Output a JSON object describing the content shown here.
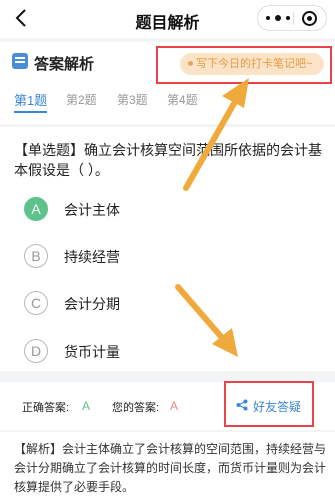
{
  "navbar": {
    "title": "题目解析",
    "back_icon": "chevron-left-icon",
    "menu_icon": "more-dots-icon",
    "record_icon": "record-circle-icon"
  },
  "section": {
    "icon": "document-icon",
    "title": "答案解析",
    "note_placeholder": "写下今日的打卡笔记吧~"
  },
  "tabs": [
    {
      "label": "第1题",
      "active": true
    },
    {
      "label": "第2题",
      "active": false
    },
    {
      "label": "第3题",
      "active": false
    },
    {
      "label": "第4题",
      "active": false
    }
  ],
  "question": {
    "text": "【单选题】确立会计核算空间范围所依据的会计基本假设是（    ）。",
    "options": [
      {
        "letter": "A",
        "text": "会计主体",
        "correct": true
      },
      {
        "letter": "B",
        "text": "持续经营",
        "correct": false
      },
      {
        "letter": "C",
        "text": "会计分期",
        "correct": false
      },
      {
        "letter": "D",
        "text": "货币计量",
        "correct": false
      }
    ]
  },
  "answer": {
    "correct_label": "正确答案:",
    "correct_value": "A",
    "yours_label": "您的答案:",
    "yours_value": "A",
    "share_label": "好友答疑",
    "share_icon": "share-icon"
  },
  "explanation": "【解析】会计主体确立了会计核算的空间范围，持续经营与会计分期确立了会计核算的时间长度，而货币计量则为会计核算提供了必要手段。",
  "colors": {
    "accent": "#3a86d6",
    "correct": "#5dc38b",
    "highlight": "#e8424b",
    "arrow": "#f0a93b",
    "wrong_answer": "#e58a8a"
  }
}
